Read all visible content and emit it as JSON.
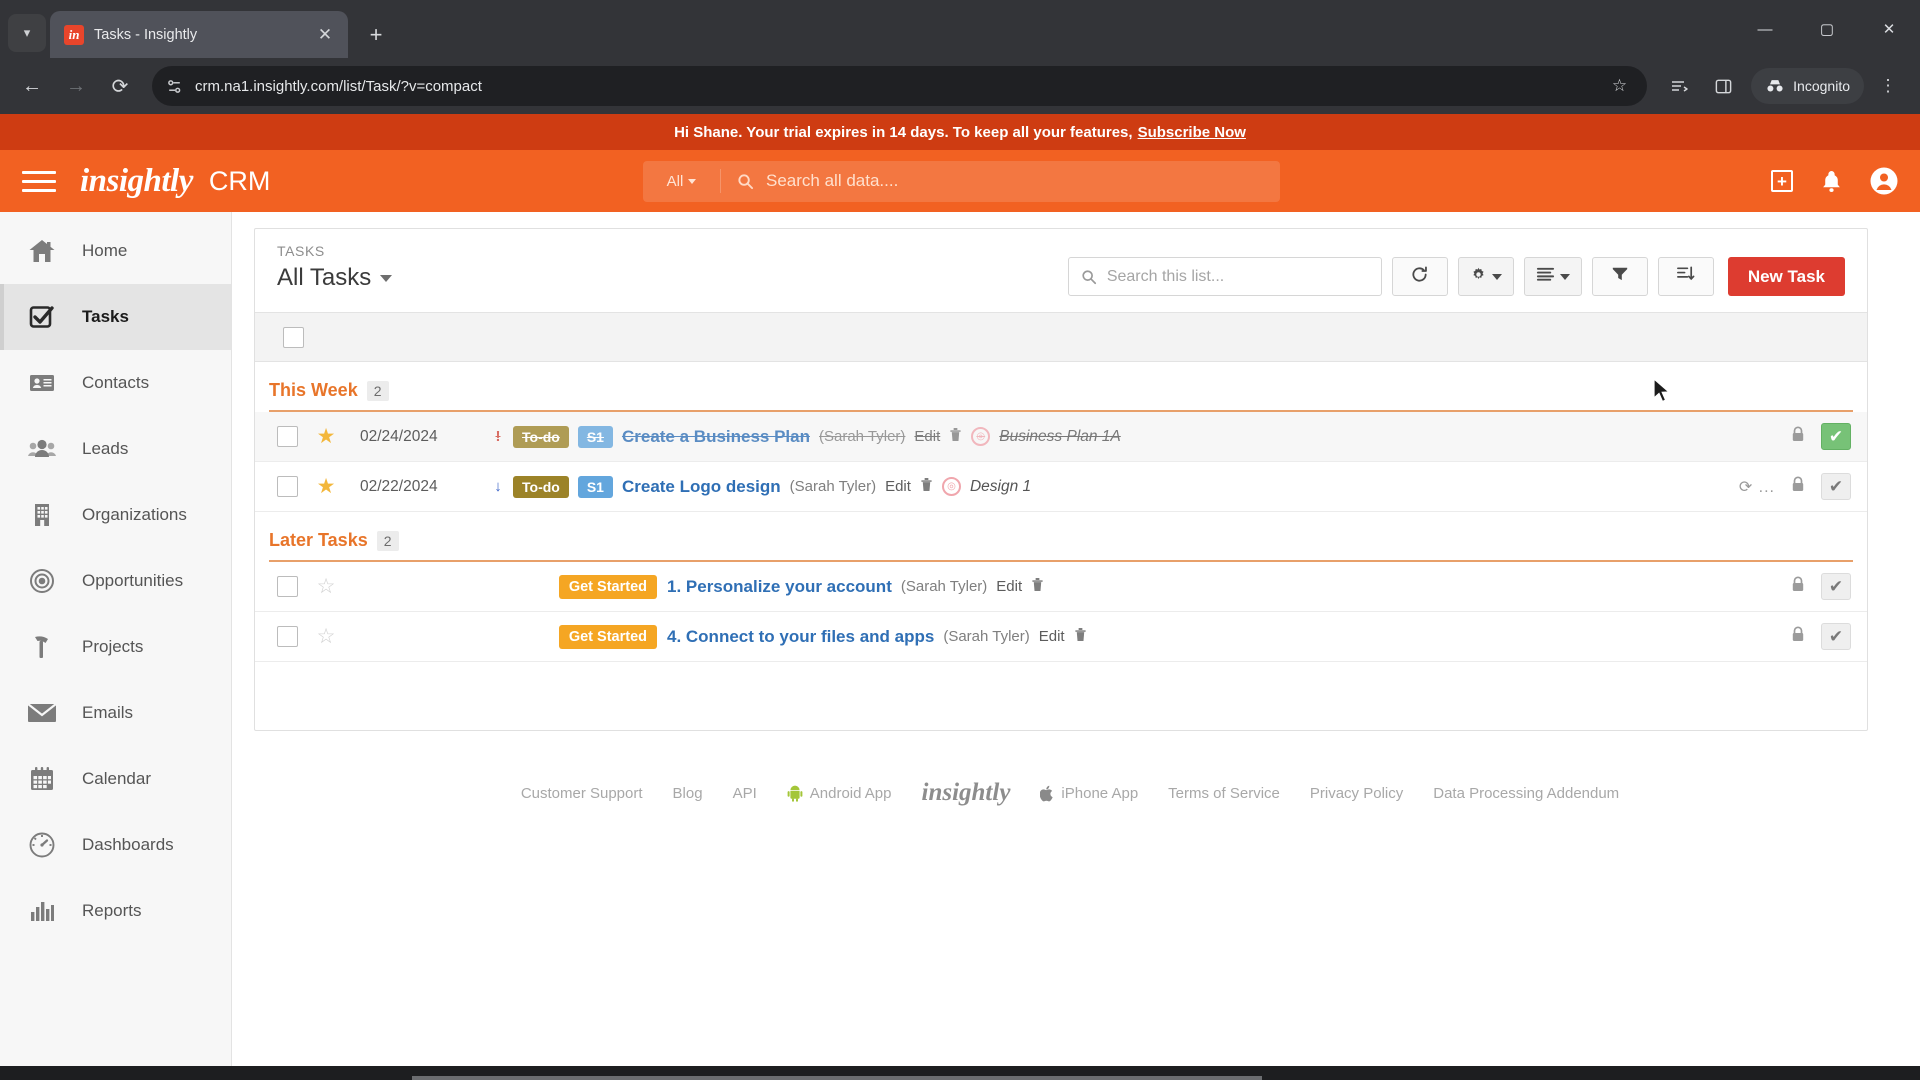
{
  "browser": {
    "tab_title": "Tasks - Insightly",
    "favicon_text": "in",
    "url": "crm.na1.insightly.com/list/Task/?v=compact",
    "incognito_label": "Incognito",
    "new_tab_label": "+",
    "close_tab_label": "✕",
    "back_label": "←",
    "forward_label": "→",
    "reload_label": "⟳",
    "star_label": "☆",
    "minimize_label": "—",
    "maximize_label": "▢",
    "close_label": "✕"
  },
  "trial_banner": {
    "message": "Hi Shane. Your trial expires in 14 days. To keep all your features,",
    "cta": "Subscribe Now"
  },
  "app_header": {
    "brand": "insightly",
    "product": "CRM",
    "search_scope": "All",
    "search_placeholder": "Search all data....",
    "icons": {
      "add": "+",
      "notifications": "🔔",
      "account": "account"
    }
  },
  "sidebar": {
    "items": [
      {
        "label": "Home",
        "icon": "home-icon",
        "active": false
      },
      {
        "label": "Tasks",
        "icon": "tasks-icon",
        "active": true
      },
      {
        "label": "Contacts",
        "icon": "contacts-icon",
        "active": false
      },
      {
        "label": "Leads",
        "icon": "leads-icon",
        "active": false
      },
      {
        "label": "Organizations",
        "icon": "organizations-icon",
        "active": false
      },
      {
        "label": "Opportunities",
        "icon": "opportunities-icon",
        "active": false
      },
      {
        "label": "Projects",
        "icon": "projects-icon",
        "active": false
      },
      {
        "label": "Emails",
        "icon": "emails-icon",
        "active": false
      },
      {
        "label": "Calendar",
        "icon": "calendar-icon",
        "active": false
      },
      {
        "label": "Dashboards",
        "icon": "dashboards-icon",
        "active": false
      },
      {
        "label": "Reports",
        "icon": "reports-icon",
        "active": false
      }
    ]
  },
  "list_header": {
    "eyebrow": "TASKS",
    "title": "All Tasks",
    "search_placeholder": "Search this list...",
    "refresh_label": "⟳",
    "settings_label": "⚙",
    "view_label": "≡",
    "filter_label": "▼",
    "sort_label": "sort",
    "new_task_label": "New Task"
  },
  "groups": [
    {
      "name": "This Week",
      "count": "2",
      "rows": [
        {
          "date": "02/24/2024",
          "starred": true,
          "priority": "!",
          "priority_type": "high",
          "status_badge": "To-do",
          "stage_badge": "S1",
          "title": "Create a Business Plan",
          "owner": "(Sarah Tyler)",
          "edit": "Edit",
          "related": "Business Plan 1A",
          "completed": true,
          "check_state": "green",
          "spinner": "",
          "locked": true
        },
        {
          "date": "02/22/2024",
          "starred": true,
          "priority": "↓",
          "priority_type": "low",
          "status_badge": "To-do",
          "stage_badge": "S1",
          "title": "Create Logo design",
          "owner": "(Sarah Tyler)",
          "edit": "Edit",
          "related": "Design 1",
          "completed": false,
          "check_state": "grey",
          "spinner": "⟳ ...",
          "locked": true
        }
      ]
    },
    {
      "name": "Later Tasks",
      "count": "2",
      "rows": [
        {
          "date": "",
          "starred": false,
          "priority": "",
          "priority_type": "",
          "status_badge": "Get Started",
          "stage_badge": "",
          "title": "1. Personalize your account",
          "owner": "(Sarah Tyler)",
          "edit": "Edit",
          "related": "",
          "completed": false,
          "check_state": "grey",
          "spinner": "",
          "locked": true
        },
        {
          "date": "",
          "starred": false,
          "priority": "",
          "priority_type": "",
          "status_badge": "Get Started",
          "stage_badge": "",
          "title": "4. Connect to your files and apps",
          "owner": "(Sarah Tyler)",
          "edit": "Edit",
          "related": "",
          "completed": false,
          "check_state": "grey",
          "spinner": "",
          "locked": true
        }
      ]
    }
  ],
  "footer": {
    "links": [
      "Customer Support",
      "Blog",
      "API",
      "Android App",
      "insightly",
      "iPhone App",
      "Terms of Service",
      "Privacy Policy",
      "Data Processing Addendum"
    ]
  },
  "colors": {
    "brand_orange": "#f26122",
    "banner_orange": "#ce3c12",
    "new_task_red": "#dd3c30",
    "group_orange": "#e8752a",
    "link_blue": "#2f6fb5",
    "badge_todo": "#9c8328",
    "badge_s1": "#63a6dd",
    "badge_getstarted": "#f5a623"
  }
}
